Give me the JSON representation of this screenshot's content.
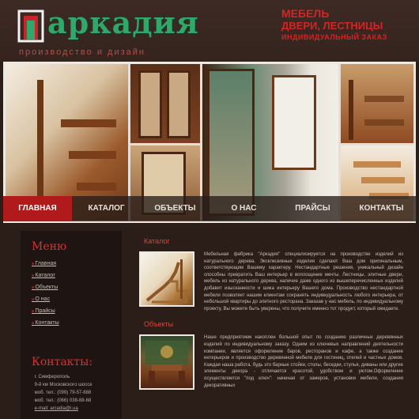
{
  "header": {
    "logo_text": "аркадия",
    "logo_sub": "производство и дизайн",
    "tagline_1": "МЕБЕЛЬ",
    "tagline_2": "ДВЕРИ, ЛЕСТНИЦЫ",
    "tagline_3": "ИНДИВИДУАЛЬНЫЙ ЗАКАЗ"
  },
  "nav": {
    "items": [
      "ГЛАВНАЯ",
      "КАТАЛОГ",
      "ОБЪЕКТЫ",
      "О НАС",
      "ПРАЙСЫ",
      "КОНТАКТЫ"
    ],
    "active": "ГЛАВНАЯ"
  },
  "sidebar": {
    "menu_title": "Меню",
    "menu": [
      "Главная",
      "Каталог",
      "Объекты",
      "О нас",
      "Прайсы",
      "Контакты"
    ],
    "contacts_title": "Контакты:",
    "contacts": [
      "г. Симферополь",
      "9-й км Московского шоссе",
      "моб. тел.: (099) 79-57-888",
      "моб. тел.: (066) 038-88-68",
      "e-mail: arcadia@i.ua"
    ]
  },
  "main": {
    "sections": [
      {
        "title": "Каталог",
        "text": "Мебельная фабрика \"Аркадия\" специализируется на производстве изделий из натурального дерева. Эксклюзивные изделия сделают Ваш дом оригинальным, соответствующим Вашему характеру. Нестандартные решения, уникальный дизайн способны превратить Ваш интерьер в воплощение мечты. Лестницы, элитные двери, мебель из натурального дерева, наличие даже одного из вышеперечисленных изделий добавит изысканности и шика интерьеру Вашего дома. Производство нестандартной мебели позволяет нашим клиентам сохранять индивидуальность любого интерьера, от небольшой квартиры до элитного ресторана. Заказав у нас мебель, по индивидуальному проекту, Вы можете быть уверены, что получите именно тот продукт, который ожидаете."
      },
      {
        "title": "Объекты",
        "text": "Наше предприятием накоплен большой опыт по созданию различных деревянных изделий по индивидуальному заказу. Одним из ключевых направлений деятельности компании, является оформление баров, ресторанов и кафе, а также создание интерьеров и производство деревянной мебели для гостиниц, отелей и частных домов. Каждая наша работа, будь это барные стойки, столы, беседки, стулья, диваны или другие элементы декора - отличается красотой, удобством и уютом.Оформление осуществляется \"под ключ\": начиная от замеров, установки мебели, создания декоративных"
      }
    ]
  },
  "colors": {
    "accent": "#d23232",
    "logo_green": "#2fa86a",
    "background": "#2b1e19",
    "nav_active": "#b11a1a"
  }
}
